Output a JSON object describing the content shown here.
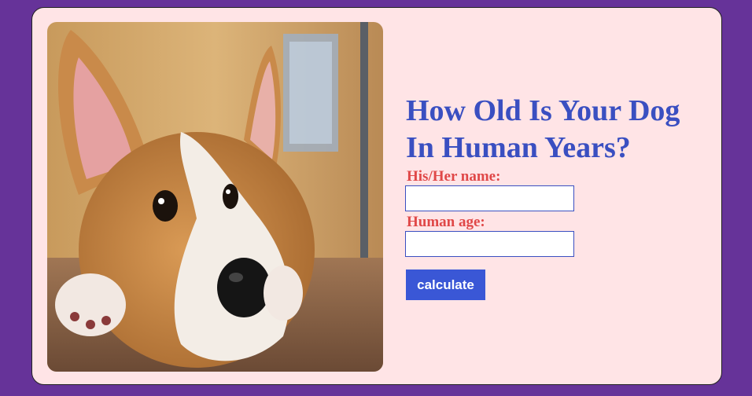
{
  "card": {
    "photo_alt": "Corgi puppy lying on the floor",
    "title_line1": "How Old Is Your Dog",
    "title_line2": "In Human Years?",
    "form": {
      "name_label": "His/Her name:",
      "name_value": "",
      "age_label": "Human age:",
      "age_value": "",
      "calculate_label": "calculate"
    }
  },
  "colors": {
    "background": "#663399",
    "card": "#ffe4e6",
    "title": "#3a4fc1",
    "label": "#e04848",
    "button": "#3a57d6"
  }
}
